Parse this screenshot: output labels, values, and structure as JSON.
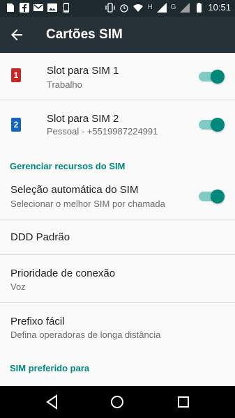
{
  "status_bar": {
    "left_icons": [
      "sim-icon",
      "facebook-icon",
      "gmail-icon",
      "image-icon",
      "phone-icon"
    ],
    "right_icons": [
      "vibrate-icon",
      "alarm-icon",
      "wifi-icon",
      "signal-h-icon",
      "signal-g-icon",
      "battery-icon"
    ],
    "network_labels": [
      "H",
      "G"
    ],
    "time": "10:51"
  },
  "header": {
    "title": "Cartões SIM"
  },
  "sims": [
    {
      "number": "1",
      "color": "#c62828",
      "title": "Slot para SIM 1",
      "subtitle": "Trabalho",
      "enabled": true
    },
    {
      "number": "2",
      "color": "#1565c0",
      "title": "Slot para SIM 2",
      "subtitle": "Pessoal - +5519987224991",
      "enabled": true
    }
  ],
  "section_manage": {
    "title": "Gerenciar recursos do SIM"
  },
  "auto_select": {
    "title": "Seleção automática do SIM",
    "subtitle": "Selecionar o melhor SIM por chamada",
    "enabled": true
  },
  "ddd": {
    "title": "DDD Padrão"
  },
  "priority": {
    "title": "Prioridade de conexão",
    "subtitle": "Voz"
  },
  "prefix": {
    "title": "Prefixo fácil",
    "subtitle": "Defina operadoras de longa distância"
  },
  "section_preferred": {
    "title": "SIM preferido para"
  },
  "colors": {
    "accent": "#00897b",
    "appbar": "#263238"
  }
}
